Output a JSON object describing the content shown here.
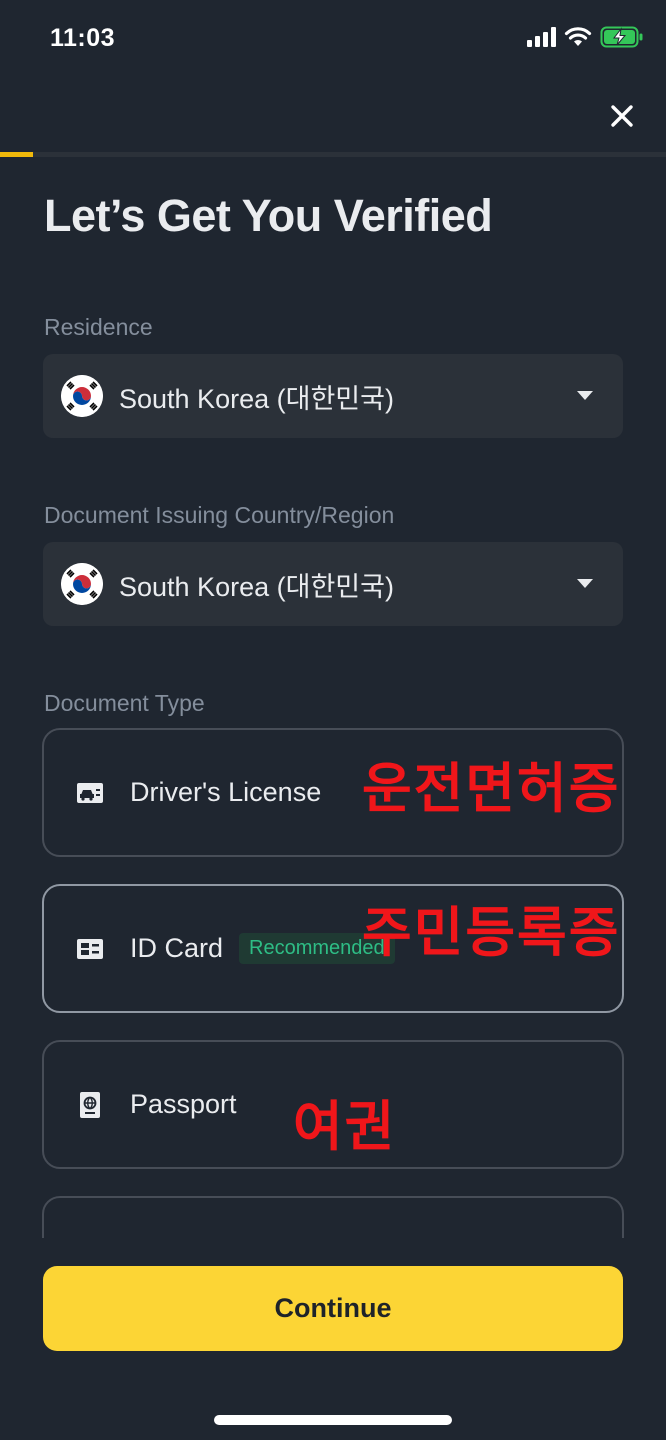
{
  "status_bar": {
    "time": "11:03",
    "icons": [
      "signal-icon",
      "wifi-icon",
      "battery-charging-icon"
    ]
  },
  "header": {
    "close_icon": "close-icon",
    "progress_fraction": 0.05,
    "progress_color": "#f0b90b"
  },
  "title": "Let’s Get You Verified",
  "residence": {
    "label": "Residence",
    "value": "South Korea (대한민국)",
    "flag_icon": "south-korea-flag-icon"
  },
  "issuing_country": {
    "label": "Document Issuing Country/Region",
    "value": "South Korea (대한민국)",
    "flag_icon": "south-korea-flag-icon"
  },
  "document_type": {
    "label": "Document Type",
    "options": [
      {
        "label": "Driver's License",
        "icon": "drivers-license-icon",
        "annotation": "운전면허증"
      },
      {
        "label": "ID Card",
        "icon": "id-card-icon",
        "badge": "Recommended",
        "annotation": "주민등록증"
      },
      {
        "label": "Passport",
        "icon": "passport-icon",
        "annotation": "여권"
      }
    ]
  },
  "continue_label": "Continue",
  "colors": {
    "background": "#1f2630",
    "surface": "#2b3139",
    "accent": "#fcd535",
    "badge_green": "#2ebd85",
    "annotation_red": "#f0161a"
  }
}
